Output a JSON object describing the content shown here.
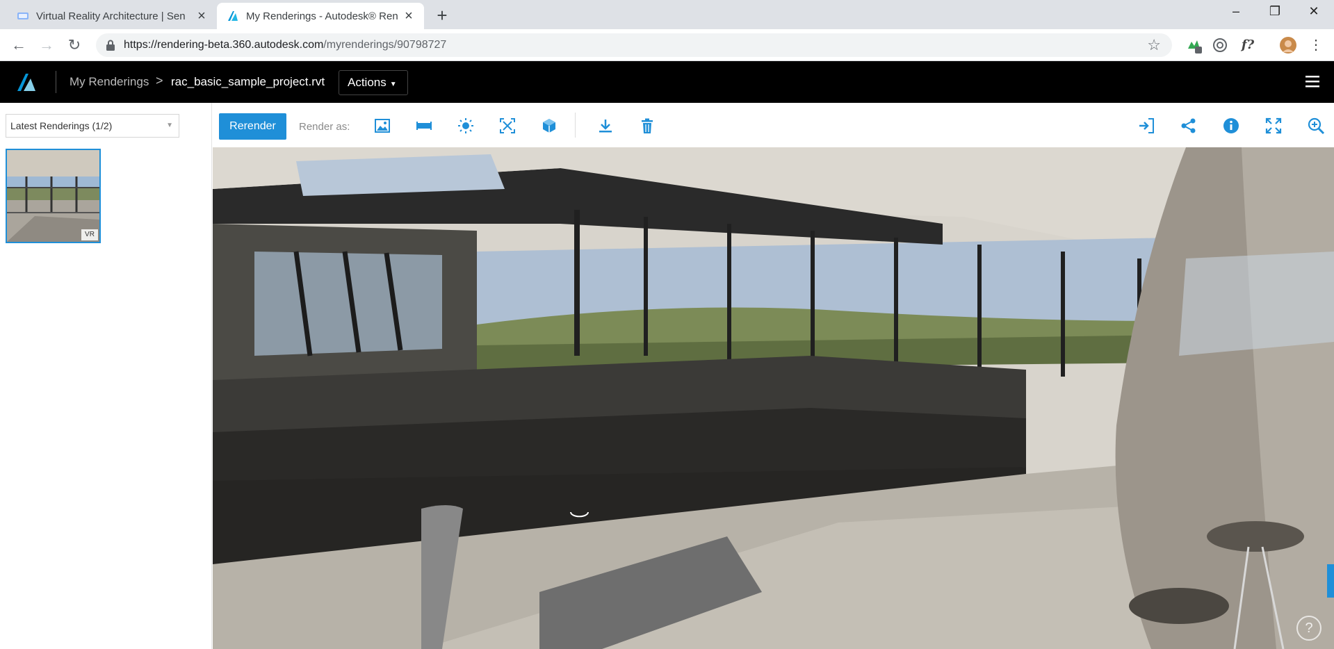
{
  "browser": {
    "tabs": [
      {
        "title": "Virtual Reality Architecture | Sen",
        "active": false
      },
      {
        "title": "My Renderings - Autodesk® Ren",
        "active": true
      }
    ],
    "new_tab_symbol": "+",
    "url_host": "https://rendering-beta.360.autodesk.com",
    "url_path": "/myrenderings/90798727",
    "window_controls": {
      "minimize": "–",
      "restore": "❐",
      "close": "✕"
    },
    "extensions": [
      "green-extension-icon",
      "chrome-ext-icon",
      "formula-ext-icon",
      "profile-avatar"
    ]
  },
  "app": {
    "breadcrumb": {
      "root": "My Renderings",
      "separator": ">",
      "current": "rac_basic_sample_project.rvt"
    },
    "actions_label": "Actions",
    "accent_color": "#1f8fd8"
  },
  "sidebar": {
    "dropdown_value": "Latest Renderings  (1/2)",
    "thumbnail_badge": "VR"
  },
  "toolbar": {
    "rerender_label": "Rerender",
    "render_as_label": "Render as:",
    "render_icons": [
      "image-icon",
      "panorama-icon",
      "sun-icon",
      "exposure-icon",
      "cube-stereo-icon"
    ],
    "action_icons": [
      "download-icon",
      "trash-icon"
    ],
    "right_icons": [
      "open-in-icon",
      "share-icon",
      "info-icon",
      "fullscreen-icon",
      "zoom-in-icon"
    ]
  },
  "viewport": {
    "help_label": "?"
  }
}
